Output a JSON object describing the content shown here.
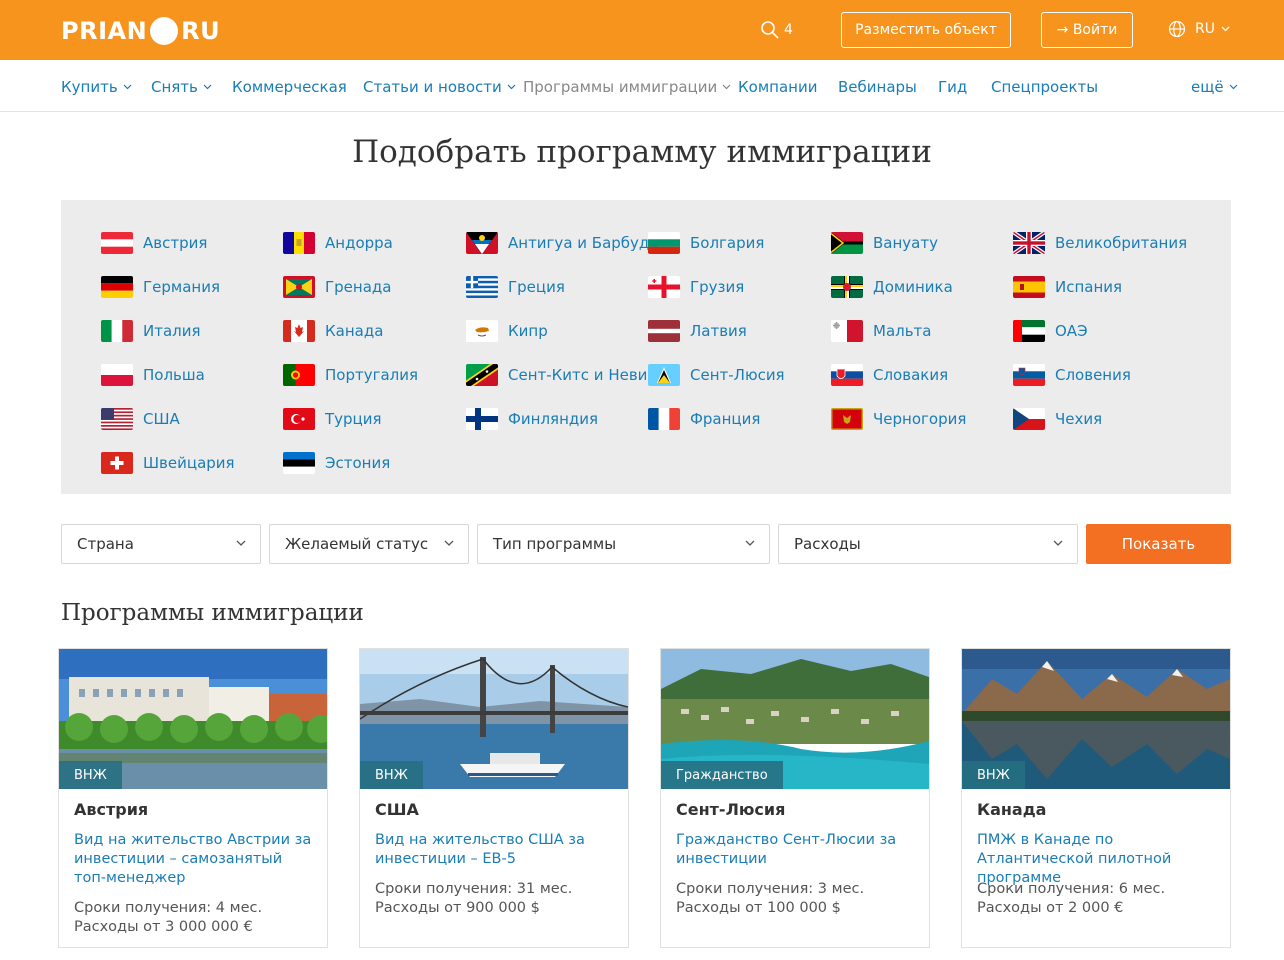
{
  "header": {
    "logo_left": "PRIAN",
    "logo_right": "RU",
    "search_count": "4",
    "place_button": "Разместить объект",
    "login_button": "→ Войти",
    "lang": "RU"
  },
  "nav": [
    {
      "label": "Купить"
    },
    {
      "label": "Снять"
    },
    {
      "label": "Коммерческая"
    },
    {
      "label": "Статьи и новости"
    },
    {
      "label": "Программы иммиграции"
    },
    {
      "label": "Компании"
    },
    {
      "label": "Вебинары"
    },
    {
      "label": "Гид"
    },
    {
      "label": "Спецпроекты"
    },
    {
      "label": "ещё"
    }
  ],
  "page_title": "Подобрать программу иммиграции",
  "countries": [
    {
      "name": "Австрия"
    },
    {
      "name": "Андорра"
    },
    {
      "name": "Антигуа и Барбуда"
    },
    {
      "name": "Болгария"
    },
    {
      "name": "Вануату"
    },
    {
      "name": "Великобритания"
    },
    {
      "name": "Германия"
    },
    {
      "name": "Гренада"
    },
    {
      "name": "Греция"
    },
    {
      "name": "Грузия"
    },
    {
      "name": "Доминика"
    },
    {
      "name": "Испания"
    },
    {
      "name": "Италия"
    },
    {
      "name": "Канада"
    },
    {
      "name": "Кипр"
    },
    {
      "name": "Латвия"
    },
    {
      "name": "Мальта"
    },
    {
      "name": "ОАЭ"
    },
    {
      "name": "Польша"
    },
    {
      "name": "Португалия"
    },
    {
      "name": "Сент-Китс и Невис"
    },
    {
      "name": "Сент-Люсия"
    },
    {
      "name": "Словакия"
    },
    {
      "name": "Словения"
    },
    {
      "name": "США"
    },
    {
      "name": "Турция"
    },
    {
      "name": "Финляндия"
    },
    {
      "name": "Франция"
    },
    {
      "name": "Черногория"
    },
    {
      "name": "Чехия"
    },
    {
      "name": "Швейцария"
    },
    {
      "name": "Эстония"
    }
  ],
  "filters": {
    "country": "Страна",
    "status": "Желаемый статус",
    "program_type": "Тип программы",
    "expenses": "Расходы",
    "show_button": "Показать"
  },
  "section_title": "Программы иммиграции",
  "cards": [
    {
      "badge": "ВНЖ",
      "country": "Австрия",
      "title": "Вид на жительство Австрии за инвестиции – самозанятый топ-менеджер",
      "term": "Сроки получения: 4 мес.",
      "cost": "Расходы от 3 000 000 €"
    },
    {
      "badge": "ВНЖ",
      "country": "США",
      "title": "Вид на жительство США за инвестиции – EB-5",
      "term": "Сроки получения: 31 мес.",
      "cost": "Расходы от 900 000 $"
    },
    {
      "badge": "Гражданство",
      "country": "Сент-Люсия",
      "title": "Гражданство Сент-Люсии за инвестиции",
      "term": "Сроки получения: 3 мес.",
      "cost": "Расходы от 100 000 $"
    },
    {
      "badge": "ВНЖ",
      "country": "Канада",
      "title": "ПМЖ в Канаде по Атлантической пилотной программе",
      "term": "Сроки получения: 6 мес.",
      "cost": "Расходы от 2 000 €"
    }
  ],
  "colors": {
    "header_bg": "#f7941d",
    "link": "#1a7db5",
    "show_button": "#f36f21"
  }
}
